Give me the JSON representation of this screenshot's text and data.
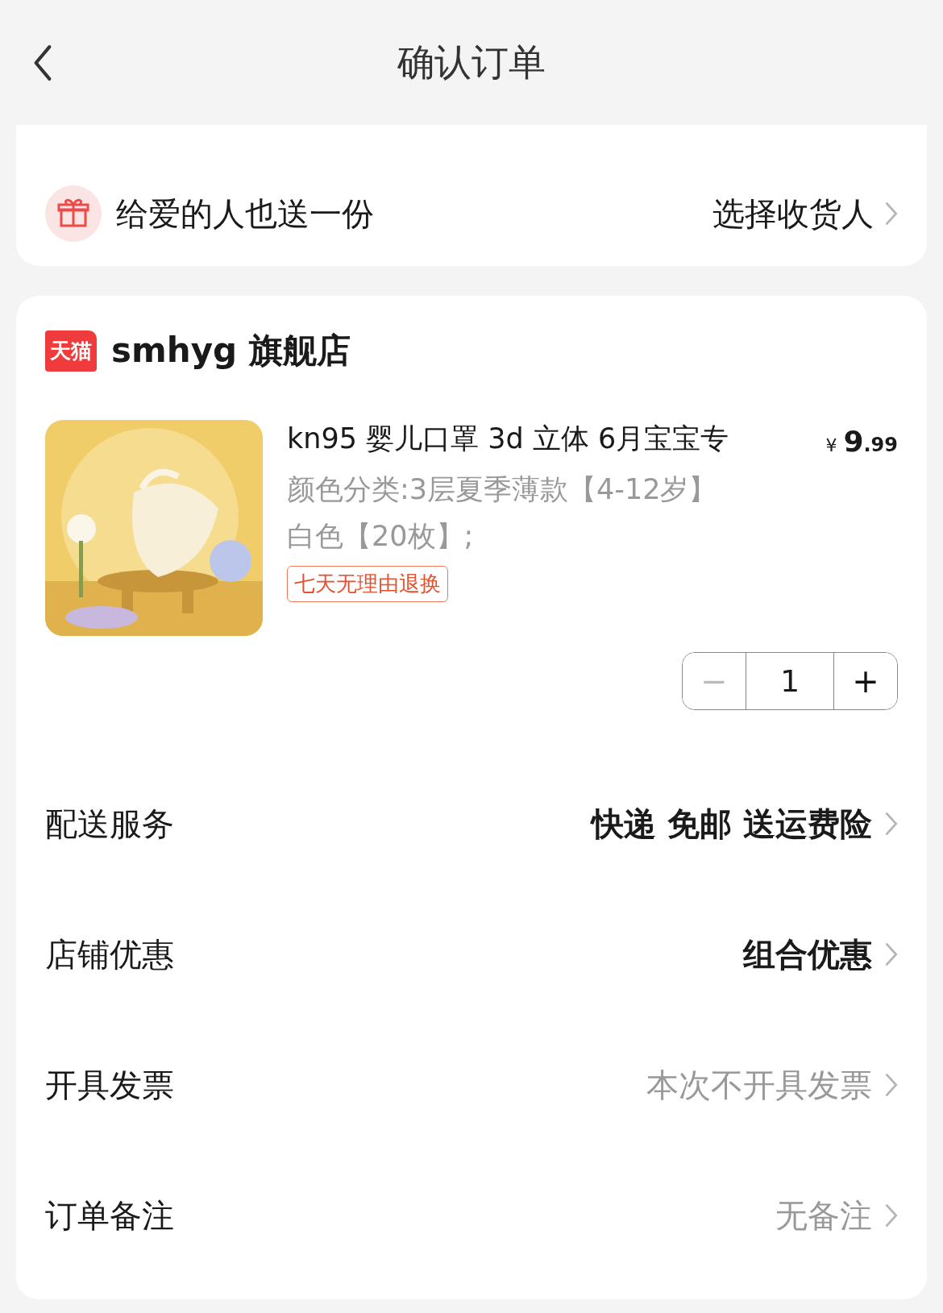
{
  "header": {
    "title": "确认订单"
  },
  "gift": {
    "label": "给爱的人也送一份",
    "action": "选择收货人"
  },
  "shop": {
    "badge": "天猫",
    "name": "smhyg 旗舰店"
  },
  "product": {
    "title": "kn95 婴儿口罩 3d 立体 6月宝宝专",
    "price": {
      "currency": "¥",
      "integer": "9",
      "decimal": ".99"
    },
    "spec": "颜色分类:3层夏季薄款【4-12岁】白色【20枚】;",
    "tag": "七天无理由退换",
    "quantity": {
      "value": "1",
      "minus": "−",
      "plus": "+",
      "minus_disabled": true
    }
  },
  "rows": [
    {
      "label": "配送服务",
      "value": "快递 免邮 送运费险",
      "kind": "emphasis"
    },
    {
      "label": "店铺优惠",
      "value": "组合优惠",
      "kind": "emphasis"
    },
    {
      "label": "开具发票",
      "value": "本次不开具发票",
      "kind": "muted"
    },
    {
      "label": "订单备注",
      "value": "无备注",
      "kind": "muted"
    }
  ]
}
